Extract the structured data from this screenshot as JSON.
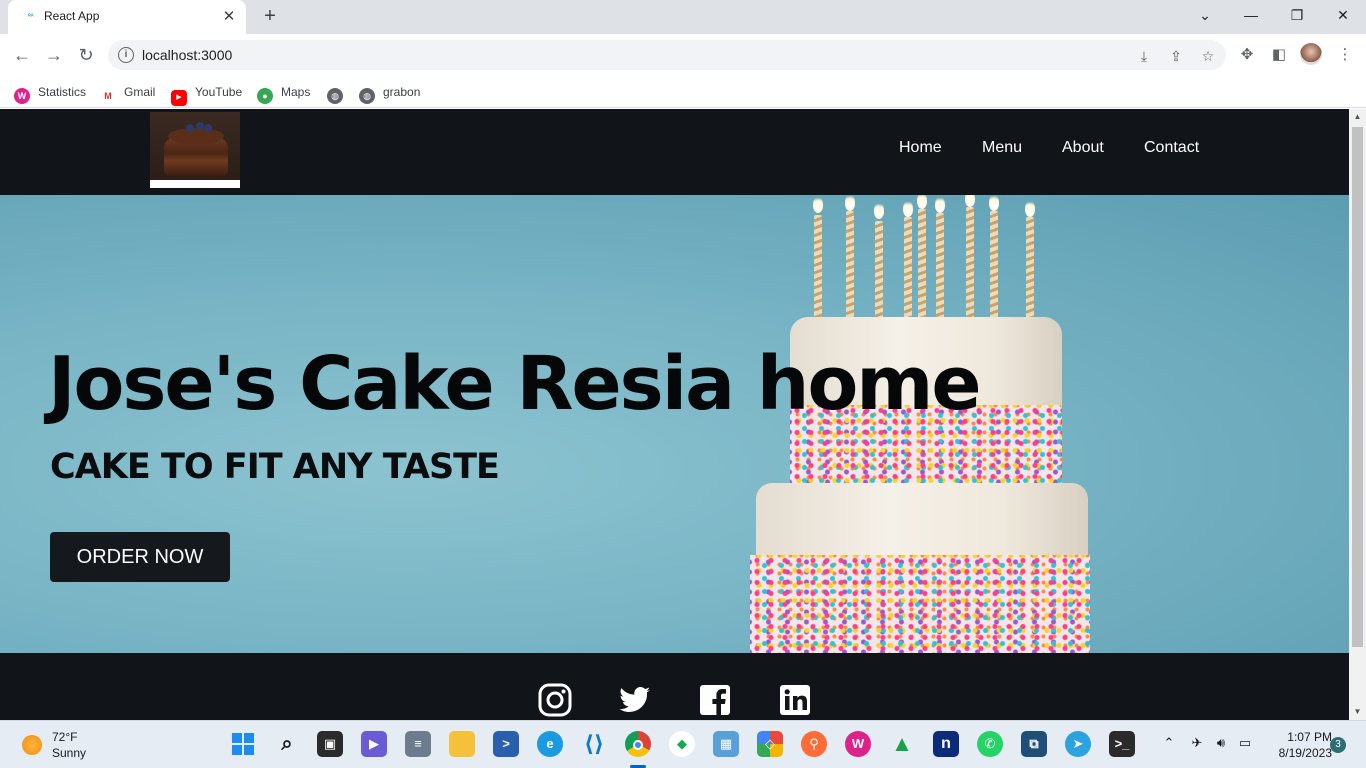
{
  "browser": {
    "tab_title": "React App",
    "tab_favicon": "React App favicon",
    "url": "localhost:3000",
    "bookmarks": [
      {
        "label": "Statistics",
        "icon": "wamp-icon"
      },
      {
        "label": "Gmail",
        "icon": "gmail-icon"
      },
      {
        "label": "YouTube",
        "icon": "youtube-icon"
      },
      {
        "label": "Maps",
        "icon": "maps-icon"
      },
      {
        "label": "",
        "icon": "globe-icon"
      },
      {
        "label": "grabon",
        "icon": "globe-icon"
      }
    ]
  },
  "site": {
    "nav": {
      "links": [
        "Home",
        "Menu",
        "About",
        "Contact"
      ]
    },
    "hero": {
      "title": "Jose's Cake Resia home",
      "subtitle": "CAKE TO FIT ANY TASTE",
      "cta": "ORDER NOW"
    },
    "footer": {
      "social": [
        "instagram-icon",
        "twitter-icon",
        "facebook-icon",
        "linkedin-icon"
      ]
    }
  },
  "taskbar": {
    "weather": {
      "temp": "72°F",
      "condition": "Sunny"
    },
    "time": "1:07 PM",
    "date": "8/19/2023",
    "notifications": "3"
  },
  "colors": {
    "nav_bg": "#111418",
    "hero_bg": "#7ab6c6",
    "button_bg": "#15181c",
    "chrome_tabstrip": "#dee1e6"
  }
}
